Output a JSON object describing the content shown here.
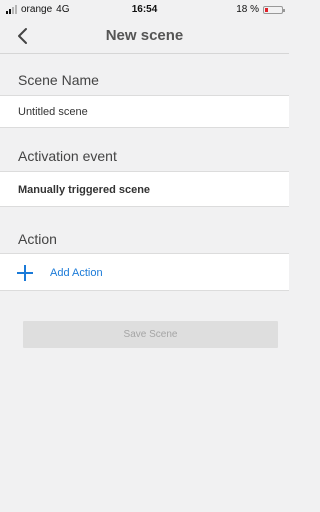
{
  "status": {
    "carrier": "orange",
    "network": "4G",
    "time": "16:54",
    "battery_text": "18 %",
    "battery_level": 0.18,
    "battery_color": "#e0202a"
  },
  "nav": {
    "title": "New scene",
    "back_icon": "chevron-left-icon"
  },
  "scene_name": {
    "header": "Scene Name",
    "value": "Untitled scene"
  },
  "activation": {
    "header": "Activation event",
    "value": "Manually triggered scene"
  },
  "action": {
    "header": "Action",
    "add_label": "Add Action",
    "add_icon": "plus-icon",
    "accent": "#1a7ad8"
  },
  "save_button": {
    "label": "Save Scene"
  }
}
